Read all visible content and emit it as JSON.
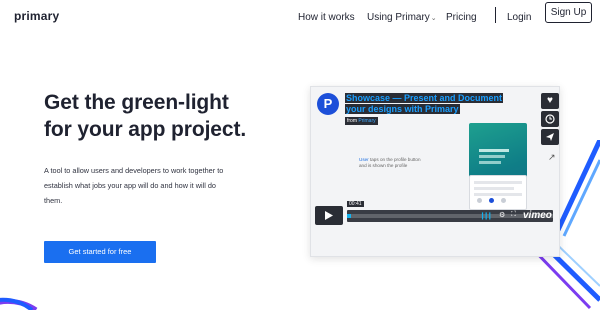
{
  "header": {
    "logo": "primary",
    "nav": [
      {
        "label": "How it works"
      },
      {
        "label": "Using Primary",
        "has_dropdown": true
      },
      {
        "label": "Pricing"
      }
    ],
    "login": "Login",
    "signup": "Sign Up"
  },
  "hero": {
    "headline_line1": "Get the green-light",
    "headline_line2": "for your app project.",
    "sub_line1": "A tool to allow users and developers to work together to",
    "sub_line2": "establish what jobs your app will do and how it will do",
    "sub_line3": "them.",
    "cta": "Get started for free"
  },
  "video": {
    "logo_letter": "P",
    "title_line1": "Showcase — Present and Document",
    "title_line2": "your designs with Primary",
    "from_label": "from",
    "from_name": "Primary",
    "slide_text_highlight": "User",
    "slide_text_rest": " taps on the profile button",
    "slide_subtext": "and is shown the profile",
    "time": "00:41",
    "progress": 0.02,
    "brand": "vimeo",
    "side_icons": [
      "heart-icon",
      "clock-icon",
      "send-icon"
    ]
  },
  "colors": {
    "accent": "#1a6ff0",
    "text": "#1f2230",
    "video_title": "#1a9fff",
    "video_chrome": "#2a2d35",
    "vimeo_blue": "#00adef",
    "deco_blue": "#1f5cff"
  }
}
